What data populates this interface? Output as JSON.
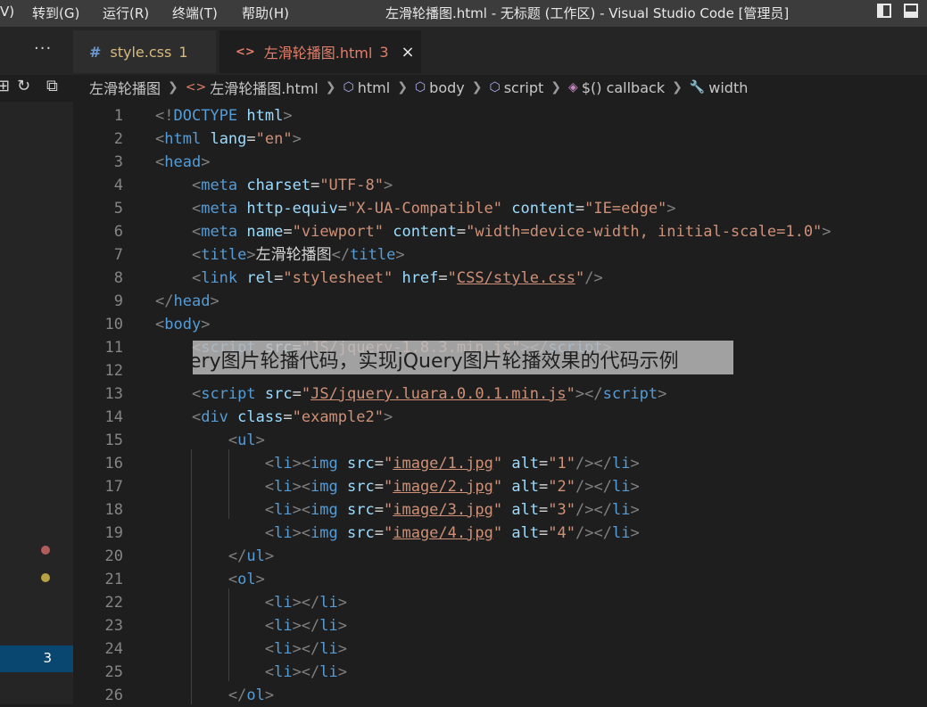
{
  "menubar": {
    "items": [
      "V)",
      "转到(G)",
      "运行(R)",
      "终端(T)",
      "帮助(H)"
    ],
    "title": "左滑轮播图.html - 无标题 (工作区) - Visual Studio Code [管理员]"
  },
  "tabs": {
    "overflow": "···",
    "items": [
      {
        "icon": "#",
        "label": "style.css",
        "badge": "1"
      },
      {
        "icon": "<>",
        "label": "左滑轮播图.html",
        "badge": "3",
        "close": "×"
      }
    ]
  },
  "breadcrumb": [
    "左滑轮播图",
    "左滑轮播图.html",
    "html",
    "body",
    "script",
    "$() callback",
    "width"
  ],
  "sidebar": {
    "problem_count": "3"
  },
  "editor": {
    "lines": [
      {
        "n": "1",
        "html": "<span class=\"p\">&lt;!</span><span class=\"t\">DOCTYPE</span> <span class=\"a\">html</span><span class=\"p\">&gt;</span>"
      },
      {
        "n": "2",
        "html": "<span class=\"p\">&lt;</span><span class=\"t\">html</span> <span class=\"a\">lang</span>=<span class=\"v\">\"en\"</span><span class=\"p\">&gt;</span>"
      },
      {
        "n": "3",
        "html": "<span class=\"p\">&lt;</span><span class=\"t\">head</span><span class=\"p\">&gt;</span>"
      },
      {
        "n": "4",
        "html": "    <span class=\"p\">&lt;</span><span class=\"t\">meta</span> <span class=\"a\">charset</span>=<span class=\"v\">\"UTF-8\"</span><span class=\"p\">&gt;</span>"
      },
      {
        "n": "5",
        "html": "    <span class=\"p\">&lt;</span><span class=\"t\">meta</span> <span class=\"a\">http-equiv</span>=<span class=\"v\">\"X-UA-Compatible\"</span> <span class=\"a\">content</span>=<span class=\"v\">\"IE=edge\"</span><span class=\"p\">&gt;</span>"
      },
      {
        "n": "6",
        "html": "    <span class=\"p\">&lt;</span><span class=\"t\">meta</span> <span class=\"a\">name</span>=<span class=\"v\">\"viewport\"</span> <span class=\"a\">content</span>=<span class=\"v\">\"width=device-width, initial-scale=1.0\"</span><span class=\"p\">&gt;</span>"
      },
      {
        "n": "7",
        "html": "    <span class=\"p\">&lt;</span><span class=\"t\">title</span><span class=\"p\">&gt;</span>左滑轮播图<span class=\"p\">&lt;/</span><span class=\"t\">title</span><span class=\"p\">&gt;</span>"
      },
      {
        "n": "8",
        "html": "    <span class=\"p\">&lt;</span><span class=\"t\">link</span> <span class=\"a\">rel</span>=<span class=\"v\">\"stylesheet\"</span> <span class=\"a\">href</span>=<span class=\"v\">\"<span class=\"u\">CSS/style.css</span>\"</span><span class=\"p\">/&gt;</span>"
      },
      {
        "n": "9",
        "html": "<span class=\"p\">&lt;/</span><span class=\"t\">head</span><span class=\"p\">&gt;</span>"
      },
      {
        "n": "10",
        "html": "<span class=\"p\">&lt;</span><span class=\"t\">body</span><span class=\"p\">&gt;</span>"
      },
      {
        "n": "11",
        "html": "    <span class=\"p\">&lt;</span><span class=\"t\">script</span> <span class=\"a\">src</span>=<span class=\"v\">\"JS/jquery-1.8.3.min.js\"</span><span class=\"p\">&gt;&lt;/</span><span class=\"t\">script</span><span class=\"p\">&gt;</span>"
      },
      {
        "n": "12",
        "html": ""
      },
      {
        "n": "13",
        "html": "    <span class=\"p\">&lt;</span><span class=\"t\">script</span> <span class=\"a\">src</span>=<span class=\"v\">\"<span class=\"u\">JS/jquery.luara.0.0.1.min.js</span>\"</span><span class=\"p\">&gt;&lt;/</span><span class=\"t\">script</span><span class=\"p\">&gt;</span>"
      },
      {
        "n": "14",
        "html": "    <span class=\"p\">&lt;</span><span class=\"t\">div</span> <span class=\"a\">class</span>=<span class=\"v\">\"example2\"</span><span class=\"p\">&gt;</span>"
      },
      {
        "n": "15",
        "html": "        <span class=\"p\">&lt;</span><span class=\"t\">ul</span><span class=\"p\">&gt;</span>"
      },
      {
        "n": "16",
        "html": "            <span class=\"p\">&lt;</span><span class=\"t\">li</span><span class=\"p\">&gt;&lt;</span><span class=\"t\">img</span> <span class=\"a\">src</span>=<span class=\"v\">\"<span class=\"u\">image/1.jpg</span>\"</span> <span class=\"a\">alt</span>=<span class=\"v\">\"1\"</span><span class=\"p\">/&gt;&lt;/</span><span class=\"t\">li</span><span class=\"p\">&gt;</span>"
      },
      {
        "n": "17",
        "html": "            <span class=\"p\">&lt;</span><span class=\"t\">li</span><span class=\"p\">&gt;&lt;</span><span class=\"t\">img</span> <span class=\"a\">src</span>=<span class=\"v\">\"<span class=\"u\">image/2.jpg</span>\"</span> <span class=\"a\">alt</span>=<span class=\"v\">\"2\"</span><span class=\"p\">/&gt;&lt;/</span><span class=\"t\">li</span><span class=\"p\">&gt;</span>"
      },
      {
        "n": "18",
        "html": "            <span class=\"p\">&lt;</span><span class=\"t\">li</span><span class=\"p\">&gt;&lt;</span><span class=\"t\">img</span> <span class=\"a\">src</span>=<span class=\"v\">\"<span class=\"u\">image/3.jpg</span>\"</span> <span class=\"a\">alt</span>=<span class=\"v\">\"3\"</span><span class=\"p\">/&gt;&lt;/</span><span class=\"t\">li</span><span class=\"p\">&gt;</span>"
      },
      {
        "n": "19",
        "html": "            <span class=\"p\">&lt;</span><span class=\"t\">li</span><span class=\"p\">&gt;&lt;</span><span class=\"t\">img</span> <span class=\"a\">src</span>=<span class=\"v\">\"<span class=\"u\">image/4.jpg</span>\"</span> <span class=\"a\">alt</span>=<span class=\"v\">\"4\"</span><span class=\"p\">/&gt;&lt;/</span><span class=\"t\">li</span><span class=\"p\">&gt;</span>"
      },
      {
        "n": "20",
        "html": "        <span class=\"p\">&lt;/</span><span class=\"t\">ul</span><span class=\"p\">&gt;</span>"
      },
      {
        "n": "21",
        "html": "        <span class=\"p\">&lt;</span><span class=\"t\">ol</span><span class=\"p\">&gt;</span>"
      },
      {
        "n": "22",
        "html": "            <span class=\"p\">&lt;</span><span class=\"t\">li</span><span class=\"p\">&gt;&lt;/</span><span class=\"t\">li</span><span class=\"p\">&gt;</span>"
      },
      {
        "n": "23",
        "html": "            <span class=\"p\">&lt;</span><span class=\"t\">li</span><span class=\"p\">&gt;&lt;/</span><span class=\"t\">li</span><span class=\"p\">&gt;</span>"
      },
      {
        "n": "24",
        "html": "            <span class=\"p\">&lt;</span><span class=\"t\">li</span><span class=\"p\">&gt;&lt;/</span><span class=\"t\">li</span><span class=\"p\">&gt;</span>"
      },
      {
        "n": "25",
        "html": "            <span class=\"p\">&lt;</span><span class=\"t\">li</span><span class=\"p\">&gt;&lt;/</span><span class=\"t\">li</span><span class=\"p\">&gt;</span>"
      },
      {
        "n": "26",
        "html": "        <span class=\"p\">&lt;/</span><span class=\"t\">ol</span><span class=\"p\">&gt;</span>"
      }
    ]
  },
  "overlay": {
    "caption": "jquery图片轮播代码，实现jQuery图片轮播效果的代码示例"
  },
  "colors": {
    "breakpoint_red": "#b35c5c",
    "warning_yellow": "#b8a243",
    "active_tab_text": "#e27e6a",
    "css_tab_text": "#d7ba7d"
  }
}
